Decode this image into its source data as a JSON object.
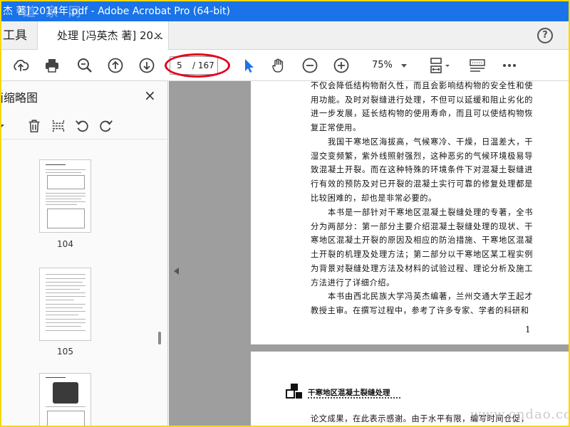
{
  "window": {
    "title": "杰 著] 2014年.pdf - Adobe Acrobat Pro (64-bit)",
    "watermark": "道 家 网"
  },
  "tabs": {
    "tools_label": "工具",
    "doc_label": "处理 [冯英杰 著] 20...",
    "close_symbol": "×",
    "help_symbol": "?"
  },
  "toolbar": {
    "page_current": "5",
    "page_total": "/ 167",
    "zoom": "75%",
    "icons": [
      "upload-icon",
      "print-icon",
      "zoom-search-icon",
      "page-up-icon",
      "page-down-icon",
      "select-cursor-icon",
      "hand-icon",
      "zoom-out-icon",
      "zoom-in-icon",
      "fit-page-icon",
      "comment-icon",
      "more-icon"
    ],
    "highlight_color": "#e3001b",
    "cursor_color": "#1a73e8"
  },
  "sidepanel": {
    "title": "页面缩略图",
    "close_symbol": "×",
    "thumbnails": [
      {
        "label": "104"
      },
      {
        "label": "105"
      },
      {
        "label": ""
      }
    ]
  },
  "document": {
    "page1": {
      "paragraphs": [
        "不仅会降低结构物耐久性，而且会影响结构物的安全性和使用功能。及时对裂缝进行处理，不但可以延缓和阻止劣化的进一步发展，延长结构物的使用寿命，而且可以使结构物恢复正常使用。",
        "　　我国干寒地区海拔高，气候寒冷、干燥，日温差大，干湿交变频繁，紫外线照射强烈，这种恶劣的气候环境极易导致混凝土开裂。而在这种特殊的环境条件下对混凝土裂缝进行有效的预防及对已开裂的混凝土实行可靠的修复处理都是比较困难的，却也是非常必要的。",
        "　　本书是一部针对干寒地区混凝土裂缝处理的专著，全书分为两部分：第一部分主要介绍混凝土裂缝处理的现状、干寒地区混凝土开裂的原因及相应的防治措施、干寒地区混凝土开裂的机理及处理方法；第二部分以干寒地区某工程实例为背景对裂缝处理方法及材料的试验过程、理论分析及施工方法进行了详细介绍。",
        "　　本书由西北民族大学冯英杰编著，兰州交通大学王起才教授主审。在撰写过程中，参考了许多专家、学者的科研和"
      ],
      "page_number": "1"
    },
    "page2": {
      "header_title": "干寒地区混凝土裂缝处理",
      "first_line": "论文成果，在此表示感谢。由于水平有限，编写时间仓促，"
    }
  },
  "overlay": {
    "bottom_watermark": "www.cndao.com"
  }
}
